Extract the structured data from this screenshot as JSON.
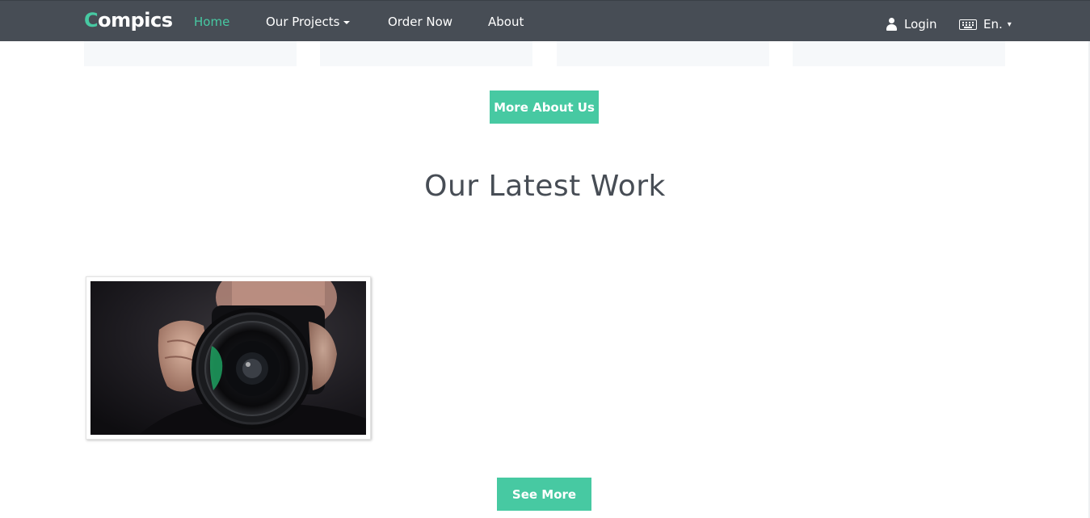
{
  "navbar": {
    "logo_first": "C",
    "logo_rest": "ompics",
    "links": [
      {
        "label": "Home",
        "active": true
      },
      {
        "label": "Our Projects",
        "dropdown": true
      },
      {
        "label": "Order Now"
      },
      {
        "label": "About"
      }
    ],
    "login_label": "Login",
    "login_icon": "user-icon",
    "language_label": "En.",
    "language_icon": "keyboard-icon",
    "language_caret": "▾"
  },
  "about": {
    "more_button": "More About Us"
  },
  "latest_work": {
    "title": "Our Latest Work",
    "items": [
      {
        "image": "photographer-with-camera"
      }
    ],
    "see_more_button": "See More"
  },
  "colors": {
    "accent": "#47c9a2",
    "navbar_bg": "#474d55",
    "heading": "#474d55",
    "card_bg": "#f6f8fa"
  }
}
